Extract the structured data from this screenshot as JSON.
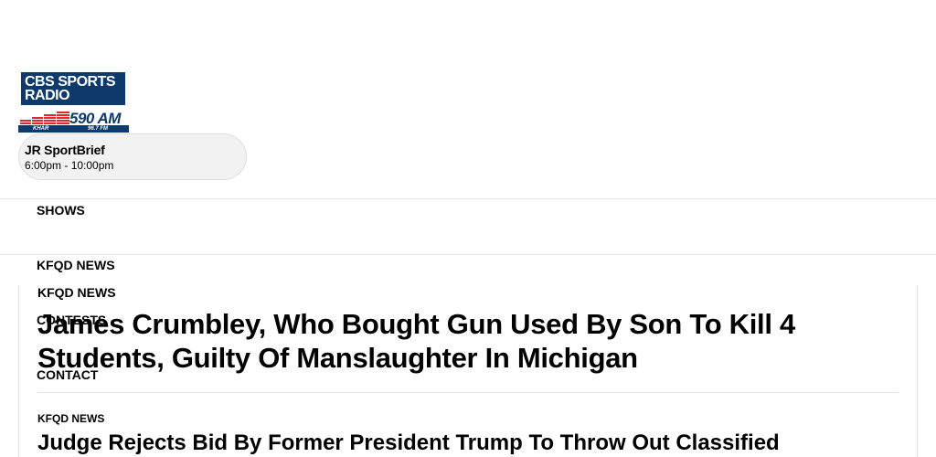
{
  "logo": {
    "line1": "CBS SPORTS",
    "line2": "RADIO",
    "frequency": "590 AM",
    "callsign": "KHAR",
    "fm": "96.7 FM",
    "brand_color": "#0d3a6b",
    "accent_color": "#e0282e"
  },
  "now_playing": {
    "show": "JR SportBrief",
    "time": "6:00pm - 10:00pm"
  },
  "nav": {
    "items": [
      {
        "label": "SHOWS"
      },
      {
        "label": "KFQD NEWS"
      },
      {
        "label": "CONTESTS"
      },
      {
        "label": "CONTACT"
      }
    ]
  },
  "feature": {
    "section": "KFQD NEWS",
    "headline": "James Crumbley, Who Bought Gun Used By Son To Kill 4 Students, Guilty Of Manslaughter In Michigan"
  },
  "next_item": {
    "section": "KFQD NEWS",
    "headline": "Judge Rejects Bid By Former President Trump To Throw Out Classified"
  }
}
